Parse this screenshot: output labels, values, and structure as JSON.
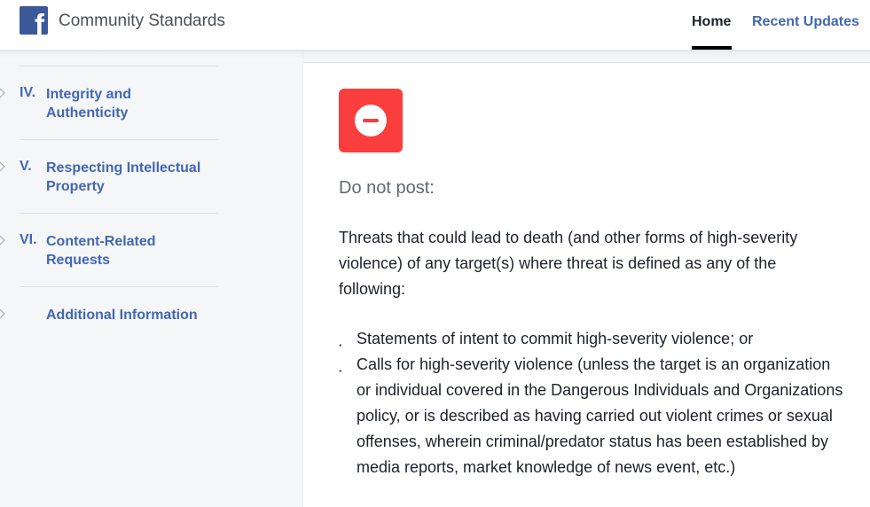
{
  "header": {
    "logo": "facebook-f-logo",
    "title": "Community Standards",
    "nav": [
      {
        "label": "Home",
        "active": true
      },
      {
        "label": "Recent Updates",
        "active": false
      }
    ]
  },
  "sidebar": {
    "items": [
      {
        "number": "IV.",
        "label": "Integrity and Authenticity"
      },
      {
        "number": "V.",
        "label": "Respecting Intellectual Property"
      },
      {
        "number": "VI.",
        "label": "Content-Related Requests"
      },
      {
        "number": "",
        "label": "Additional Information"
      }
    ]
  },
  "main": {
    "icon": "block-minus-icon",
    "icon_color": "#fa3e3e",
    "heading": "Do not post:",
    "paragraph": "Threats that could lead to death (and other forms of high-severity violence) of any target(s) where threat is defined as any of the following:",
    "bullets": [
      "Statements of intent to commit high-severity violence; or",
      "Calls for high-severity violence (unless the target is an organization or individual covered in the Dangerous Individuals and Organizations policy, or is described as having carried out violent crimes or sexual offenses, wherein criminal/predator status has been established by media reports, market knowledge of news event, etc.)"
    ]
  }
}
